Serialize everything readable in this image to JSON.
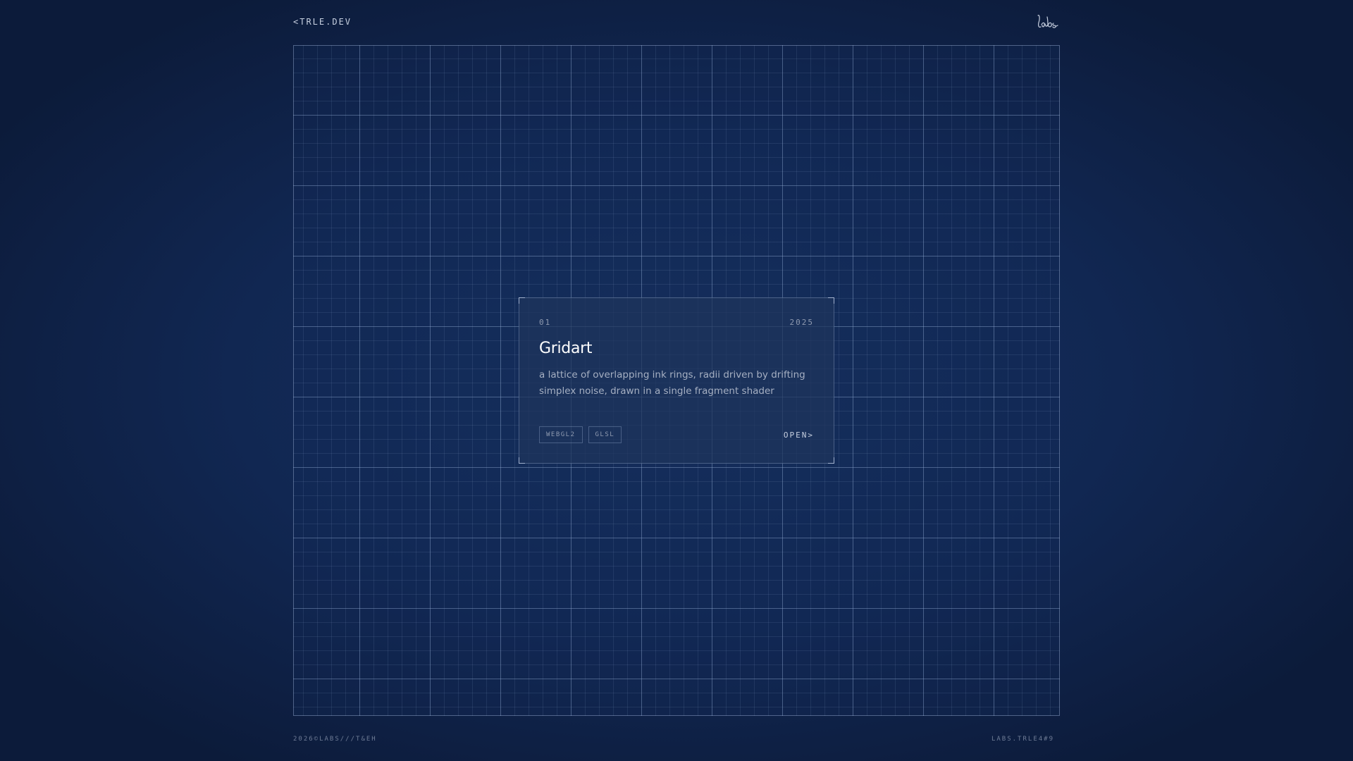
{
  "header": {
    "home_link": "<TRLE.DEV",
    "logo_icon": "labs-script-logo"
  },
  "card": {
    "index": "01",
    "year": "2025",
    "title": "Gridart",
    "description": "a lattice of overlapping ink rings, radii driven by drifting simplex noise, drawn in a single fragment shader",
    "tags": [
      "WEBGL2",
      "GLSL"
    ],
    "open_label": "OPEN>"
  },
  "footer": {
    "left": "2026©LABS///T&EH",
    "right": "LABS.TRLE4#9"
  },
  "colors": {
    "background": "#102247",
    "grid_line": "#96afd7",
    "card_bg": "#1e345c",
    "text_primary": "#ffffff",
    "text_muted": "#8f9ab0"
  }
}
